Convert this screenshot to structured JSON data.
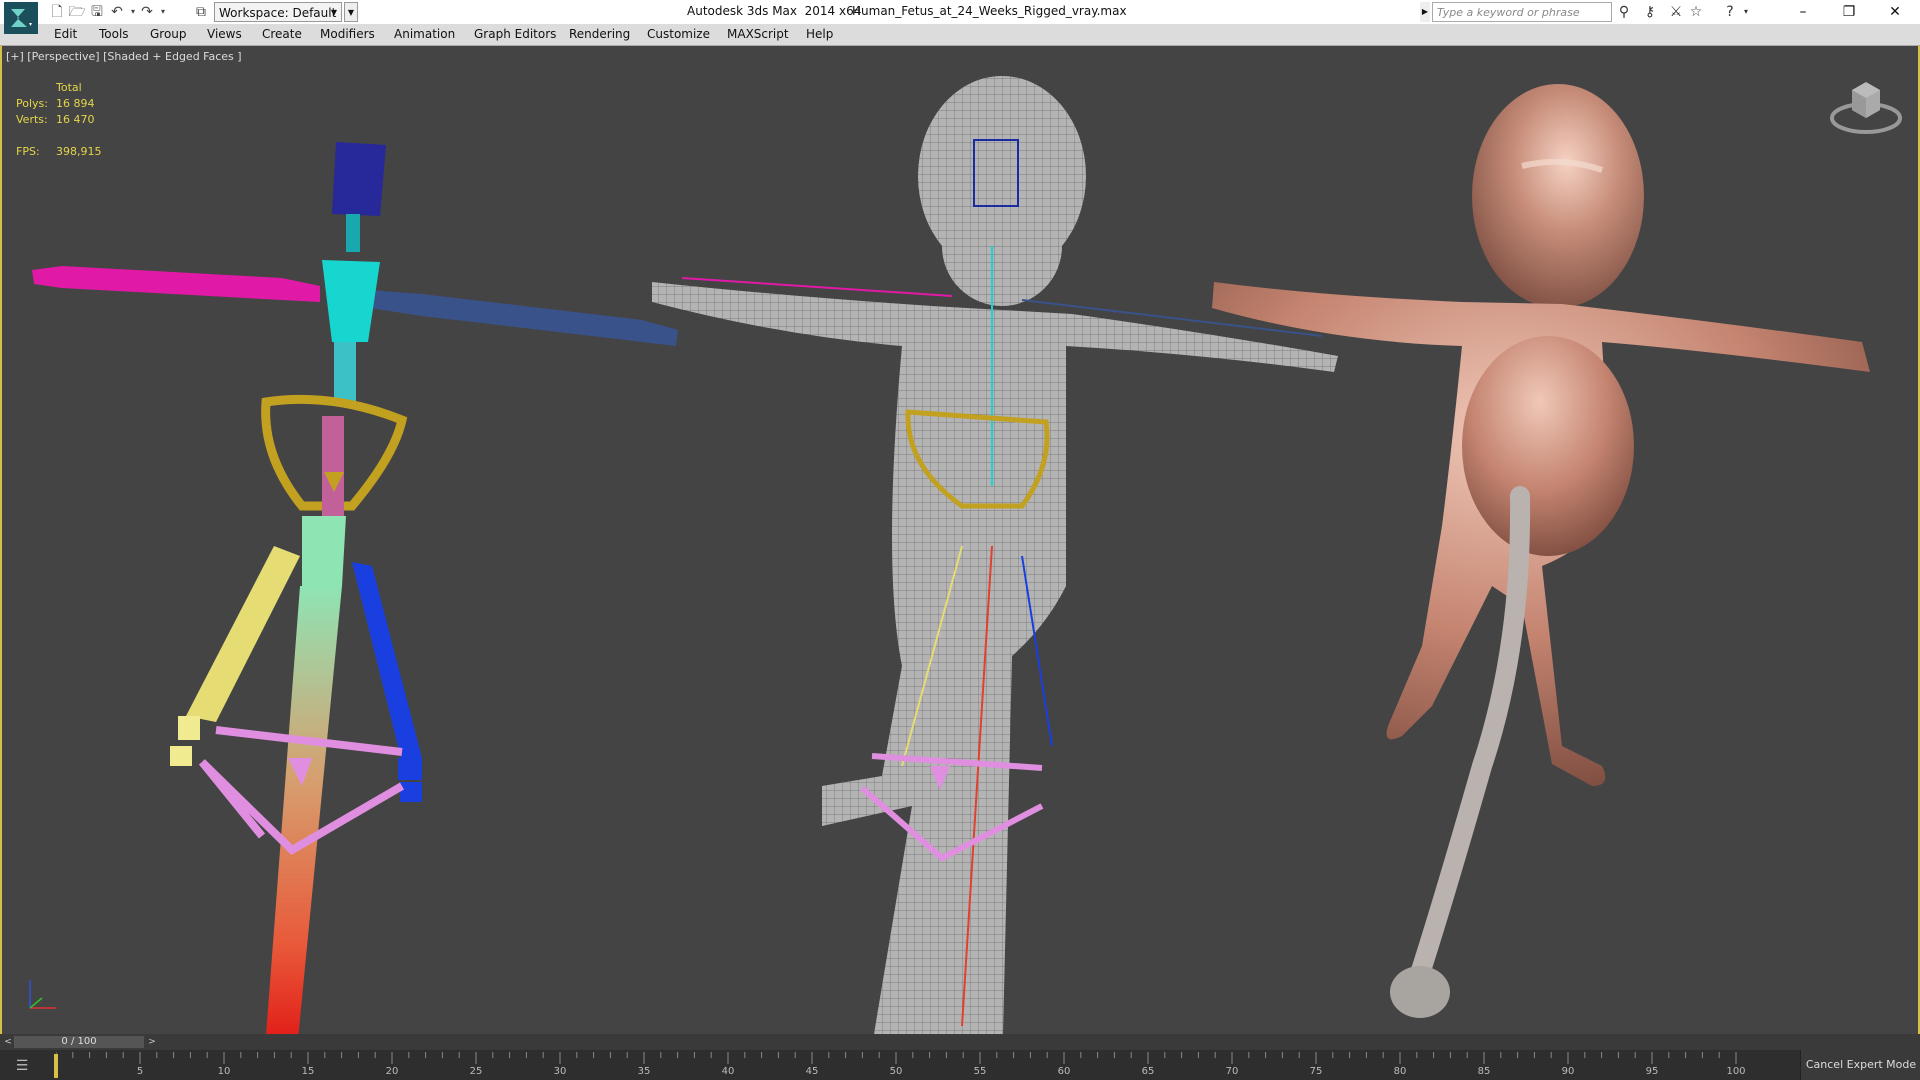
{
  "titlebar": {
    "workspace_label": "Workspace: Default",
    "app_title": "Autodesk 3ds Max  2014 x64",
    "file_name": "Human_Fetus_at_24_Weeks_Rigged_vray.max",
    "search_placeholder": "Type a keyword or phrase",
    "minimize": "–",
    "restore": "❐",
    "close": "✕"
  },
  "menu": {
    "items": [
      "Edit",
      "Tools",
      "Group",
      "Views",
      "Create",
      "Modifiers",
      "Animation",
      "Graph Editors",
      "Rendering",
      "Customize",
      "MAXScript",
      "Help"
    ]
  },
  "viewport": {
    "label": "[+] [Perspective] [Shaded + Edged Faces ]",
    "stats": {
      "header": "Total",
      "polys_label": "Polys:",
      "polys_value": "16 894",
      "verts_label": "Verts:",
      "verts_value": "16 470",
      "fps_label": "FPS:",
      "fps_value": "398,915"
    }
  },
  "timeline": {
    "frame_display": "0 / 100",
    "prev_arrow": "<",
    "next_arrow": ">",
    "ticks": [
      "5",
      "10",
      "15",
      "20",
      "25",
      "30",
      "35",
      "40",
      "45",
      "50",
      "55",
      "60",
      "65",
      "70",
      "75",
      "80",
      "85",
      "90",
      "95",
      "100"
    ],
    "cancel_expert": "Cancel Expert Mode"
  },
  "colors": {
    "accent_frame": "#d8c046",
    "viewport_bg": "#444444",
    "rig_magenta": "#e01aa6",
    "rig_cyan": "#16d6cf",
    "rig_navy": "#27289a",
    "rig_blue": "#1a3fe0",
    "rig_yellow": "#e6dc74",
    "rig_gold": "#c2a020",
    "rig_pink": "#e08fe0",
    "skin": "#c98774"
  }
}
